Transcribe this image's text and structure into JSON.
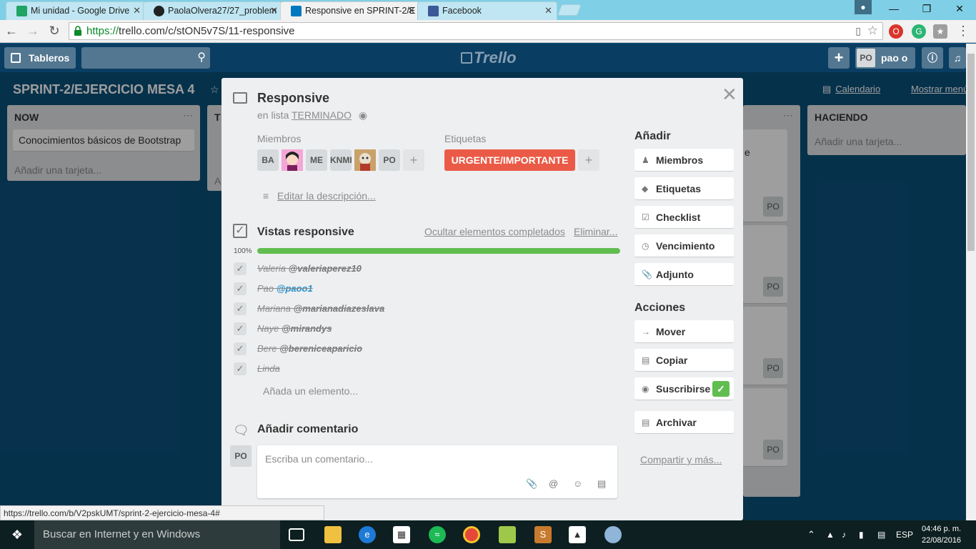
{
  "browser": {
    "tabs": [
      {
        "title": "Mi unidad - Google Drive",
        "active": false,
        "color": "#1fa463"
      },
      {
        "title": "PaolaOlvera27/27_problem",
        "active": false,
        "color": "#222222"
      },
      {
        "title": "Responsive en SPRINT-2/E",
        "active": true,
        "color": "#0079bf"
      },
      {
        "title": "Facebook",
        "active": false,
        "color": "#3b5998"
      }
    ],
    "close_glyph": "✕",
    "url_scheme": "https://",
    "url_rest": "trello.com/c/stON5v7S/11-responsive",
    "status_url": "https://trello.com/b/V2pskUMT/sprint-2-ejercicio-mesa-4#"
  },
  "trello_header": {
    "boards_label": "Tableros",
    "logo": "Trello",
    "user_initials": "PO",
    "user_name": "pao o"
  },
  "board": {
    "title": "SPRINT-2/EJERCICIO MESA 4",
    "calendar": "Calendario",
    "menu": "Mostrar menú",
    "lists": [
      {
        "title": "NOW",
        "cards": [
          "Conocimientos básicos de Bootstrap"
        ],
        "add": "Añadir una tarjeta..."
      },
      {
        "title": "HACIENDO",
        "add": "Añadir una tarjeta..."
      }
    ],
    "partial_list_letter": "T",
    "partial_add": "A",
    "partial_card_letter": "e",
    "right_avatar": "PO"
  },
  "card": {
    "title": "Responsive",
    "in_list_prefix": "en lista",
    "list_name": "TERMINADO",
    "members_label": "Miembros",
    "members": [
      "BA",
      "",
      "ME",
      "KNMI",
      "",
      "PO"
    ],
    "labels_label": "Etiquetas",
    "label": "URGENTE/IMPORTANTE",
    "edit_description": "Editar la descripción...",
    "checklist": {
      "title": "Vistas responsive",
      "hide_completed": "Ocultar elementos completados",
      "delete": "Eliminar...",
      "percent_text": "100%",
      "progress": 1.0,
      "items": [
        {
          "name": "Valeria",
          "handle": "@valeriaperez10",
          "link": false
        },
        {
          "name": "Pao",
          "handle": "@paoo1",
          "link": true
        },
        {
          "name": "Mariana",
          "handle": "@marianadiazeslava",
          "link": false
        },
        {
          "name": "Naye",
          "handle": "@mirandys",
          "link": false
        },
        {
          "name": "Bere",
          "handle": "@bereniceaparicio",
          "link": false
        },
        {
          "name": "Linda",
          "handle": "",
          "link": false
        }
      ],
      "add_item": "Añada un elemento..."
    },
    "comment": {
      "title": "Añadir comentario",
      "avatar": "PO",
      "placeholder": "Escriba un comentario..."
    },
    "sidebar": {
      "add_heading": "Añadir",
      "add_buttons": [
        "Miembros",
        "Etiquetas",
        "Checklist",
        "Vencimiento",
        "Adjunto"
      ],
      "actions_heading": "Acciones",
      "action_buttons": [
        "Mover",
        "Copiar",
        "Suscribirse",
        "Archivar"
      ],
      "share": "Compartir y más..."
    }
  },
  "taskbar": {
    "search_placeholder": "Buscar en Internet y en Windows",
    "language": "ESP",
    "time": "04:46 p. m.",
    "date": "22/08/2016"
  },
  "colors": {
    "board_bg": "#0b4f7a",
    "label_red": "#eb5a46",
    "progress_green": "#61bd4f"
  }
}
